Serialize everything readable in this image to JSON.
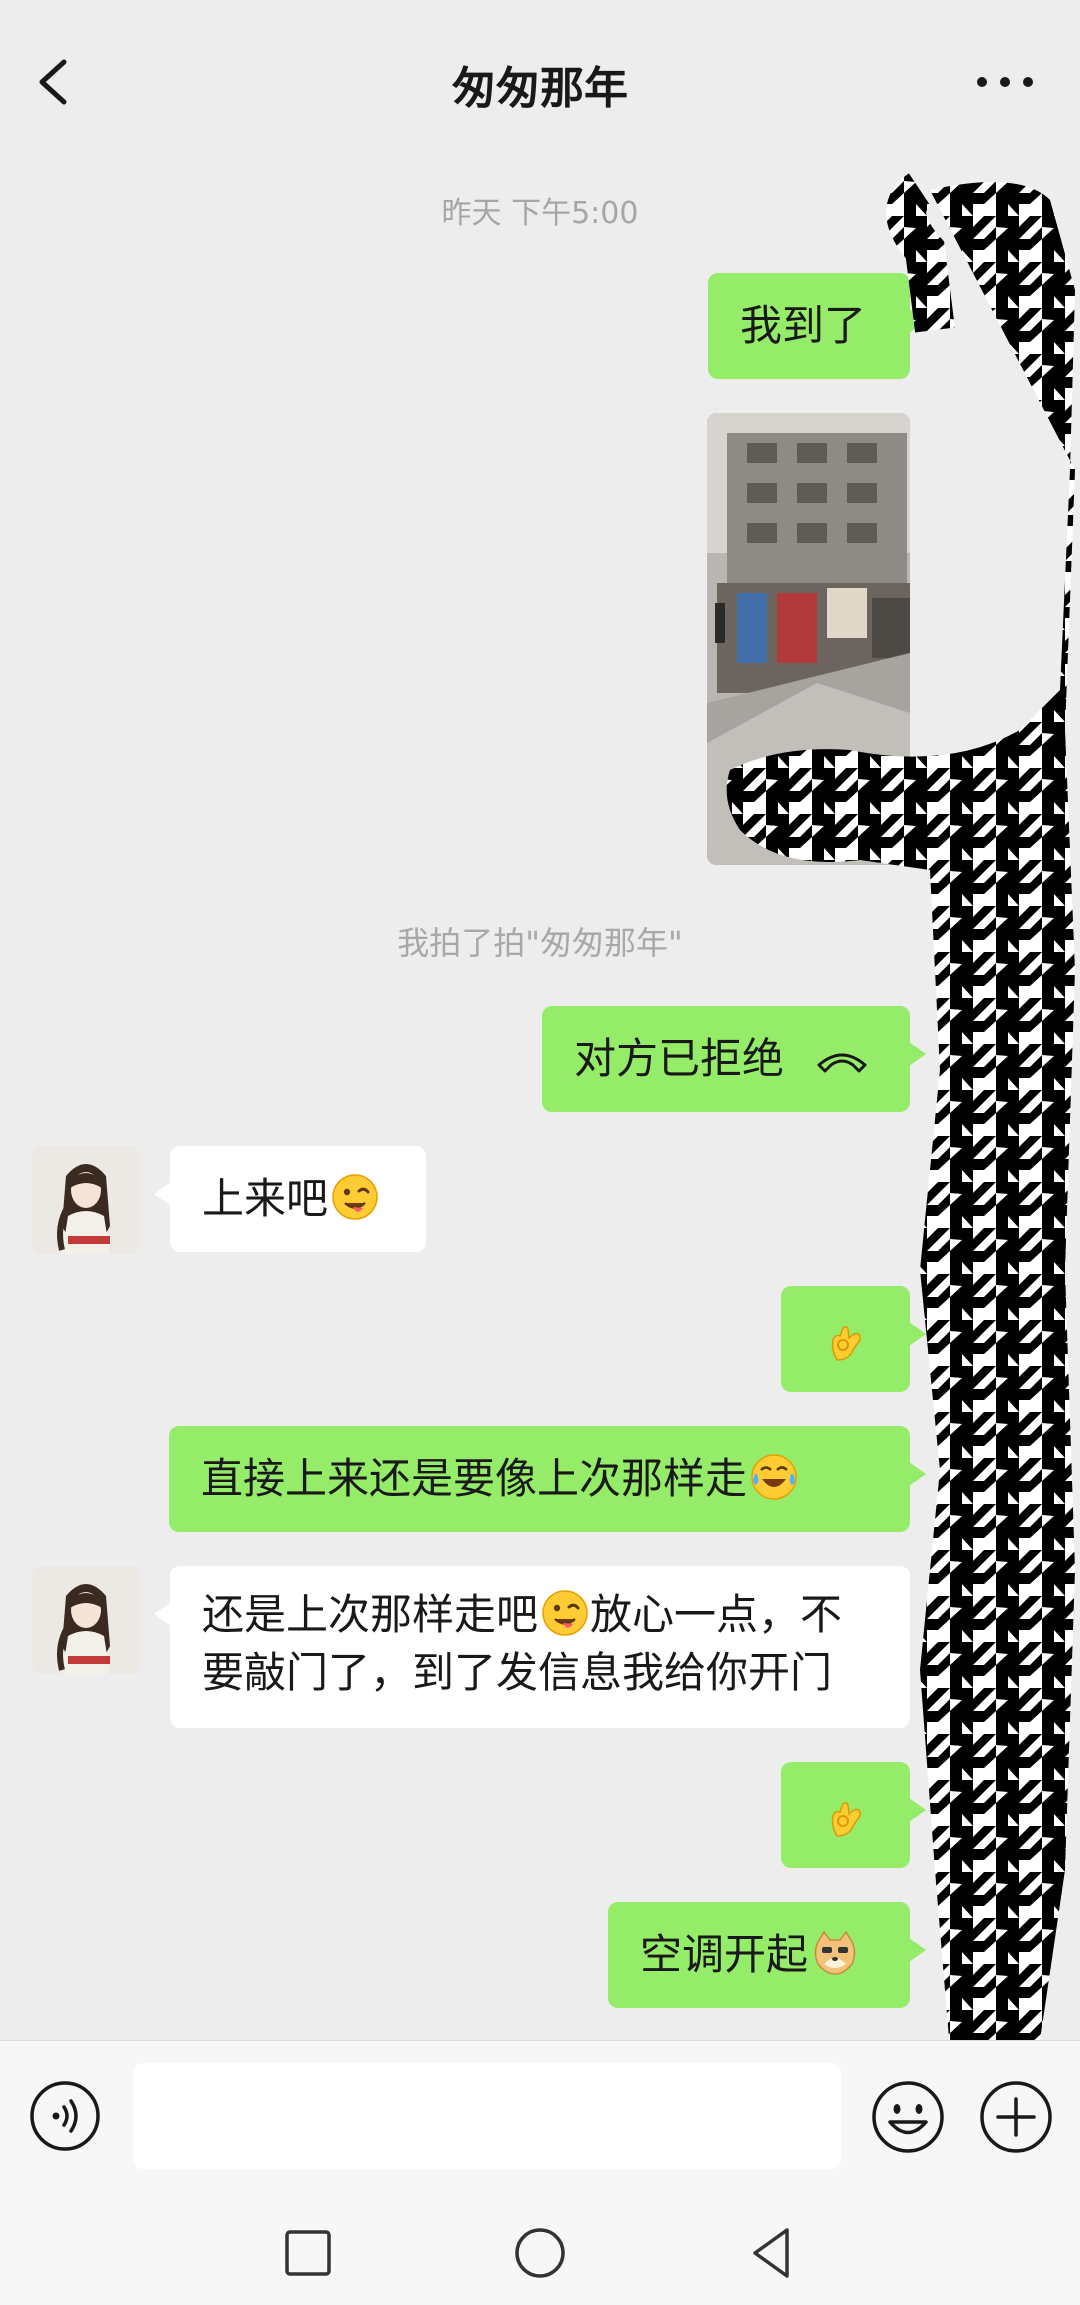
{
  "header": {
    "title": "匆匆那年",
    "back_icon": "chevron-left-icon",
    "more_icon": "more-dots-icon"
  },
  "conversation": {
    "time_separator": "昨天 下午5:00",
    "system_note": "我拍了拍\"匆匆那年\"",
    "messages": [
      {
        "from": "me",
        "type": "text",
        "text": "我到了"
      },
      {
        "from": "me",
        "type": "image"
      },
      {
        "from": "me",
        "type": "call",
        "text": "对方已拒绝",
        "icon": "hangup-phone-icon"
      },
      {
        "from": "them",
        "type": "text",
        "text": "上来吧",
        "emoji": "wink-tongue-emoji"
      },
      {
        "from": "me",
        "type": "emoji",
        "emoji": "ok-hand-emoji"
      },
      {
        "from": "me",
        "type": "text",
        "text": "直接上来还是要像上次那样走",
        "emoji": "laugh-tears-emoji"
      },
      {
        "from": "them",
        "type": "text",
        "line1": "还是上次那样走吧",
        "line1_after": "放心一点，不",
        "line2": "要敲门了，到了发信息我给你开门",
        "emoji": "wink-tongue-emoji"
      },
      {
        "from": "me",
        "type": "emoji",
        "emoji": "ok-hand-emoji"
      },
      {
        "from": "me",
        "type": "text",
        "text": "空调开起",
        "emoji": "doge-emoji"
      }
    ]
  },
  "input_bar": {
    "value": "",
    "voice_icon": "voice-icon",
    "emoji_icon": "smiley-icon",
    "plus_icon": "plus-circle-icon"
  },
  "nav_bar": {
    "recents_icon": "square-icon",
    "home_icon": "circle-icon",
    "back_icon": "triangle-back-icon"
  },
  "colors": {
    "background": "#ededed",
    "my_bubble": "#95ec69",
    "their_bubble": "#ffffff"
  }
}
